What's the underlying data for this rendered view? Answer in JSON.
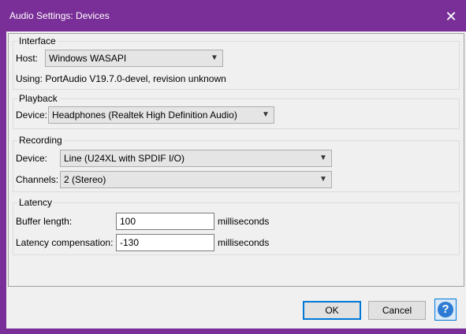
{
  "window": {
    "title": "Audio Settings: Devices",
    "close_glyph": "✕",
    "accent_color": "#7a2f98"
  },
  "interface": {
    "group_title": "Interface",
    "host_label": "Host:",
    "host_value": "Windows WASAPI",
    "using_text": "Using: PortAudio V19.7.0-devel, revision unknown"
  },
  "playback": {
    "group_title": "Playback",
    "device_label": "Device:",
    "device_value": "Headphones (Realtek High Definition Audio)"
  },
  "recording": {
    "group_title": "Recording",
    "device_label": "Device:",
    "device_value": "Line (U24XL with SPDIF I/O)",
    "channels_label": "Channels:",
    "channels_value": "2 (Stereo)"
  },
  "latency": {
    "group_title": "Latency",
    "buffer_label": "Buffer length:",
    "buffer_value": "100",
    "buffer_unit": "milliseconds",
    "compensation_label": "Latency compensation:",
    "compensation_value": "-130",
    "compensation_unit": "milliseconds"
  },
  "buttons": {
    "ok": "OK",
    "cancel": "Cancel",
    "help_glyph": "?"
  },
  "icons": {
    "dropdown": "chevron-down-icon",
    "close": "close-icon",
    "help": "help-icon"
  }
}
